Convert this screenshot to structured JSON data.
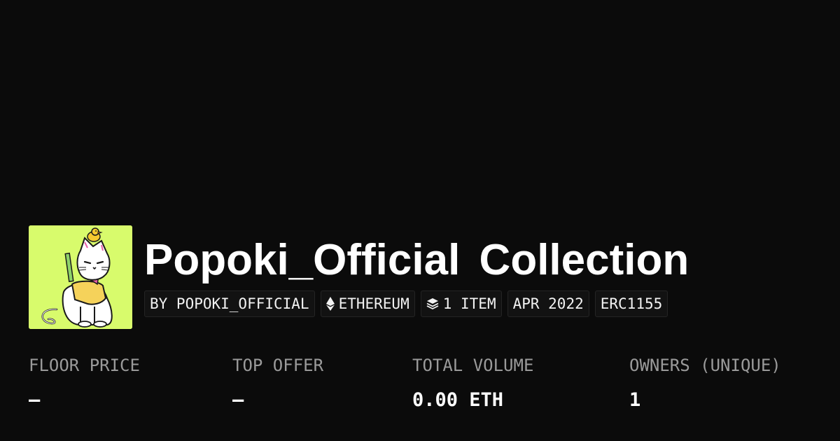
{
  "collection": {
    "title": "Popoki_Official Collection",
    "avatar_bg": "#d8fb6c"
  },
  "chips": {
    "creator": "BY POPOKI_OFFICIAL",
    "chain": "ETHEREUM",
    "chain_icon": "ethereum-icon",
    "items": "1 ITEM",
    "items_icon": "layers-icon",
    "date": "APR 2022",
    "standard": "ERC1155"
  },
  "stats": {
    "floor_price": {
      "label": "FLOOR PRICE",
      "value": "—"
    },
    "top_offer": {
      "label": "TOP OFFER",
      "value": "—"
    },
    "total_volume": {
      "label": "TOTAL VOLUME",
      "value": "0.00 ETH"
    },
    "owners": {
      "label": "OWNERS (UNIQUE)",
      "value": "1"
    }
  },
  "colors": {
    "background": "#0b0b0b",
    "text": "#ffffff",
    "muted": "#9a9a9a",
    "chip_bg": "#121212",
    "chip_border": "#242424"
  }
}
